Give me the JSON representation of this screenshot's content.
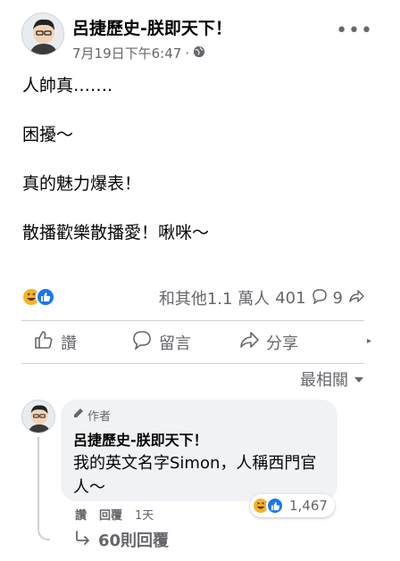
{
  "post": {
    "author": "呂捷歷史-朕即天下！",
    "timestamp": "7月19日下午6:47",
    "dot": "·",
    "privacy_icon": "globe-icon",
    "more_icon": "more-horizontal-icon",
    "more_label": "•••",
    "lines": [
      "人帥真…….",
      "困擾～",
      "真的魅力爆表！",
      "散播歡樂散播愛！啾咪～"
    ]
  },
  "stats": {
    "reaction_icons": [
      "haha-icon",
      "like-icon"
    ],
    "others_text": "和其他1.1 萬人",
    "comments_count": "401",
    "shares_count": "9"
  },
  "actions": {
    "like_label": "讚",
    "comment_label": "留言",
    "share_label": "分享"
  },
  "sort": {
    "label": "最相關"
  },
  "comment": {
    "badge": "作者",
    "author": "呂捷歷史-朕即天下！",
    "text": "我的英文名字Simon，人稱西門官人～",
    "reaction_count": "1,467",
    "like_label": "讚",
    "reply_label": "回覆",
    "age": "1天",
    "replies_label": "60則回覆"
  },
  "colors": {
    "text": "#050505",
    "secondary": "#65676b",
    "divider": "#ced0d4",
    "like_blue": "#1877f2",
    "haha_yellow": "#f7b125",
    "bubble": "#f0f2f5"
  }
}
